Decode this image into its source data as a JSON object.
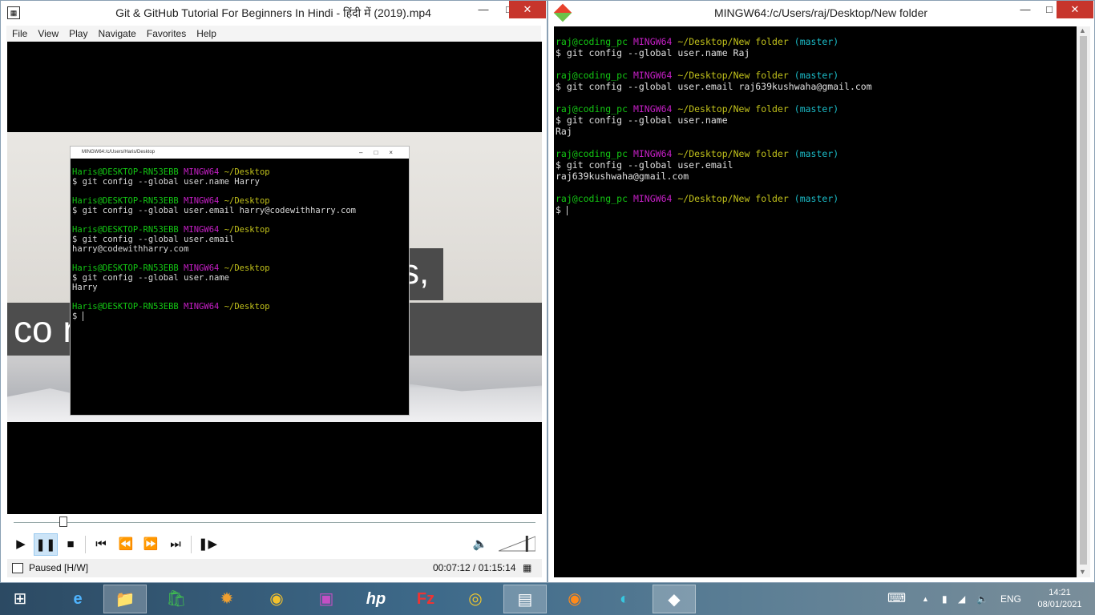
{
  "mpc": {
    "title": "Git & GitHub Tutorial For Beginners In Hindi - हिंदी में (2019).mp4",
    "app_icon": "film-icon",
    "menu": [
      "File",
      "View",
      "Play",
      "Navigate",
      "Favorites",
      "Help"
    ],
    "video_caption_line1": "s,",
    "video_caption_line2": "co                            nes do.",
    "inner_window_title": "MINGW64:/c/Users/Haris/Desktop",
    "inner_terminal": [
      {
        "user": "Haris@DESKTOP-RN53EBB",
        "shell": "MINGW64",
        "path": "~/Desktop",
        "cmd": "$ git config --global user.name Harry",
        "out": ""
      },
      {
        "user": "Haris@DESKTOP-RN53EBB",
        "shell": "MINGW64",
        "path": "~/Desktop",
        "cmd": "$ git config --global user.email harry@codewithharry.com",
        "out": ""
      },
      {
        "user": "Haris@DESKTOP-RN53EBB",
        "shell": "MINGW64",
        "path": "~/Desktop",
        "cmd": "$ git config --global user.email",
        "out": "harry@codewithharry.com"
      },
      {
        "user": "Haris@DESKTOP-RN53EBB",
        "shell": "MINGW64",
        "path": "~/Desktop",
        "cmd": "$ git config --global user.name",
        "out": "Harry"
      },
      {
        "user": "Haris@DESKTOP-RN53EBB",
        "shell": "MINGW64",
        "path": "~/Desktop",
        "cmd": "$ ",
        "out": ""
      }
    ],
    "status_text": "Paused [H/W]",
    "time_text": "00:07:12 / 01:15:14",
    "seek_progress": 0.096,
    "volume_level": 0.8
  },
  "bash": {
    "title": "MINGW64:/c/Users/raj/Desktop/New folder",
    "terminal": [
      {
        "user": "raj@coding_pc",
        "shell": "MINGW64",
        "path": "~/Desktop/New folder",
        "branch": "(master)",
        "cmd": "$ git config --global user.name Raj",
        "out": ""
      },
      {
        "user": "raj@coding_pc",
        "shell": "MINGW64",
        "path": "~/Desktop/New folder",
        "branch": "(master)",
        "cmd": "$ git config --global user.email raj639kushwaha@gmail.com",
        "out": ""
      },
      {
        "user": "raj@coding_pc",
        "shell": "MINGW64",
        "path": "~/Desktop/New folder",
        "branch": "(master)",
        "cmd": "$ git config --global user.name",
        "out": "Raj"
      },
      {
        "user": "raj@coding_pc",
        "shell": "MINGW64",
        "path": "~/Desktop/New folder",
        "branch": "(master)",
        "cmd": "$ git config --global user.email",
        "out": "raj639kushwaha@gmail.com"
      },
      {
        "user": "raj@coding_pc",
        "shell": "MINGW64",
        "path": "~/Desktop/New folder",
        "branch": "(master)",
        "cmd": "$ ",
        "out": ""
      }
    ]
  },
  "taskbar": {
    "apps": [
      "windows-start-icon",
      "internet-explorer-icon",
      "file-explorer-icon",
      "store-icon",
      "paint-icon",
      "media-player-icon",
      "wireless-display-icon",
      "hp-icon",
      "filezilla-icon",
      "chrome-icon",
      "mpc-hc-icon",
      "firefox-icon",
      "edge-icon",
      "git-bash-icon"
    ],
    "language": "ENG",
    "time": "14:21",
    "date": "08/01/2021"
  },
  "colors": {
    "prompt_user": "#13c613",
    "prompt_shell": "#c51fc5",
    "prompt_path": "#c1c11b",
    "prompt_branch": "#1bbcc8",
    "close_button": "#c7352c"
  }
}
